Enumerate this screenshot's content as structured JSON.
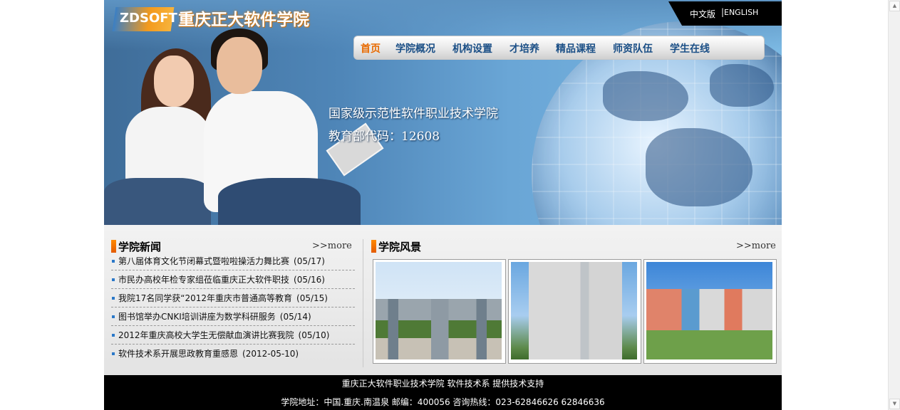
{
  "header": {
    "logo_text": "ZDSOFT",
    "site_title": "重庆正大软件学院",
    "lang_zh": "中文版",
    "lang_sep": "|",
    "lang_en": "ENGLISH",
    "slogan_line1": "国家级示范性软件职业技术学院",
    "slogan_line2": "教育部代码：12608"
  },
  "nav": {
    "items": [
      "首页",
      "学院概况",
      "机构设置",
      "才培养",
      "精品课程",
      "师资队伍",
      "学生在线"
    ],
    "active_index": 0
  },
  "news": {
    "title": "学院新闻",
    "more": ">>more",
    "items": [
      {
        "text": "第八届体育文化节闭幕式暨啦啦操活力舞比赛",
        "date": "(05/17)"
      },
      {
        "text": "市民办高校年检专家组莅临重庆正大软件职技",
        "date": "(05/16)"
      },
      {
        "text": "我院17名同学获“2012年重庆市普通高等教育",
        "date": "(05/15)"
      },
      {
        "text": "图书馆举办CNKI培训讲座为数学科研服务",
        "date": "(05/14)"
      },
      {
        "text": "2012年重庆高校大学生无偿献血演讲比赛我院",
        "date": "(05/10)"
      },
      {
        "text": "软件技术系开展思政教育重感恩",
        "date": "(2012-05-10)"
      }
    ]
  },
  "scenery": {
    "title": "学院风景",
    "more": ">>more"
  },
  "footer": {
    "line1": "重庆正大软件职业技术学院 软件技术系 提供技术支持",
    "line2": "学院地址：中国.重庆.南温泉 邮编：400056 咨询热线：023-62846626 62846636"
  },
  "colors": {
    "accent_orange": "#e86a00",
    "nav_text": "#1b4f86",
    "footer_bg": "#000000"
  }
}
